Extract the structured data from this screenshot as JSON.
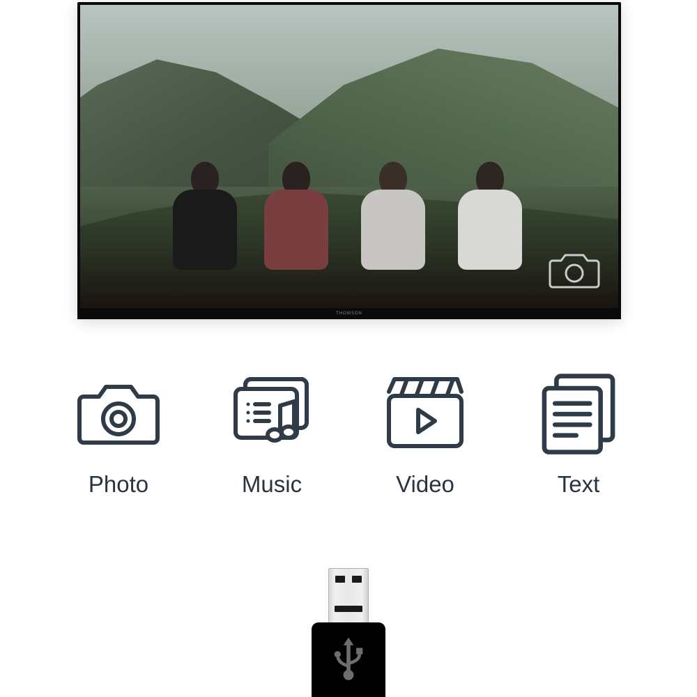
{
  "tv": {
    "brand": "THOMSON",
    "overlay_icon": "camera-icon"
  },
  "media": {
    "items": [
      {
        "icon": "photo-icon",
        "label": "Photo"
      },
      {
        "icon": "music-icon",
        "label": "Music"
      },
      {
        "icon": "video-icon",
        "label": "Video"
      },
      {
        "icon": "text-icon",
        "label": "Text"
      }
    ]
  },
  "usb": {
    "symbol": "usb-icon"
  },
  "colors": {
    "stroke": "#2f3b47",
    "label": "#2a3440"
  }
}
